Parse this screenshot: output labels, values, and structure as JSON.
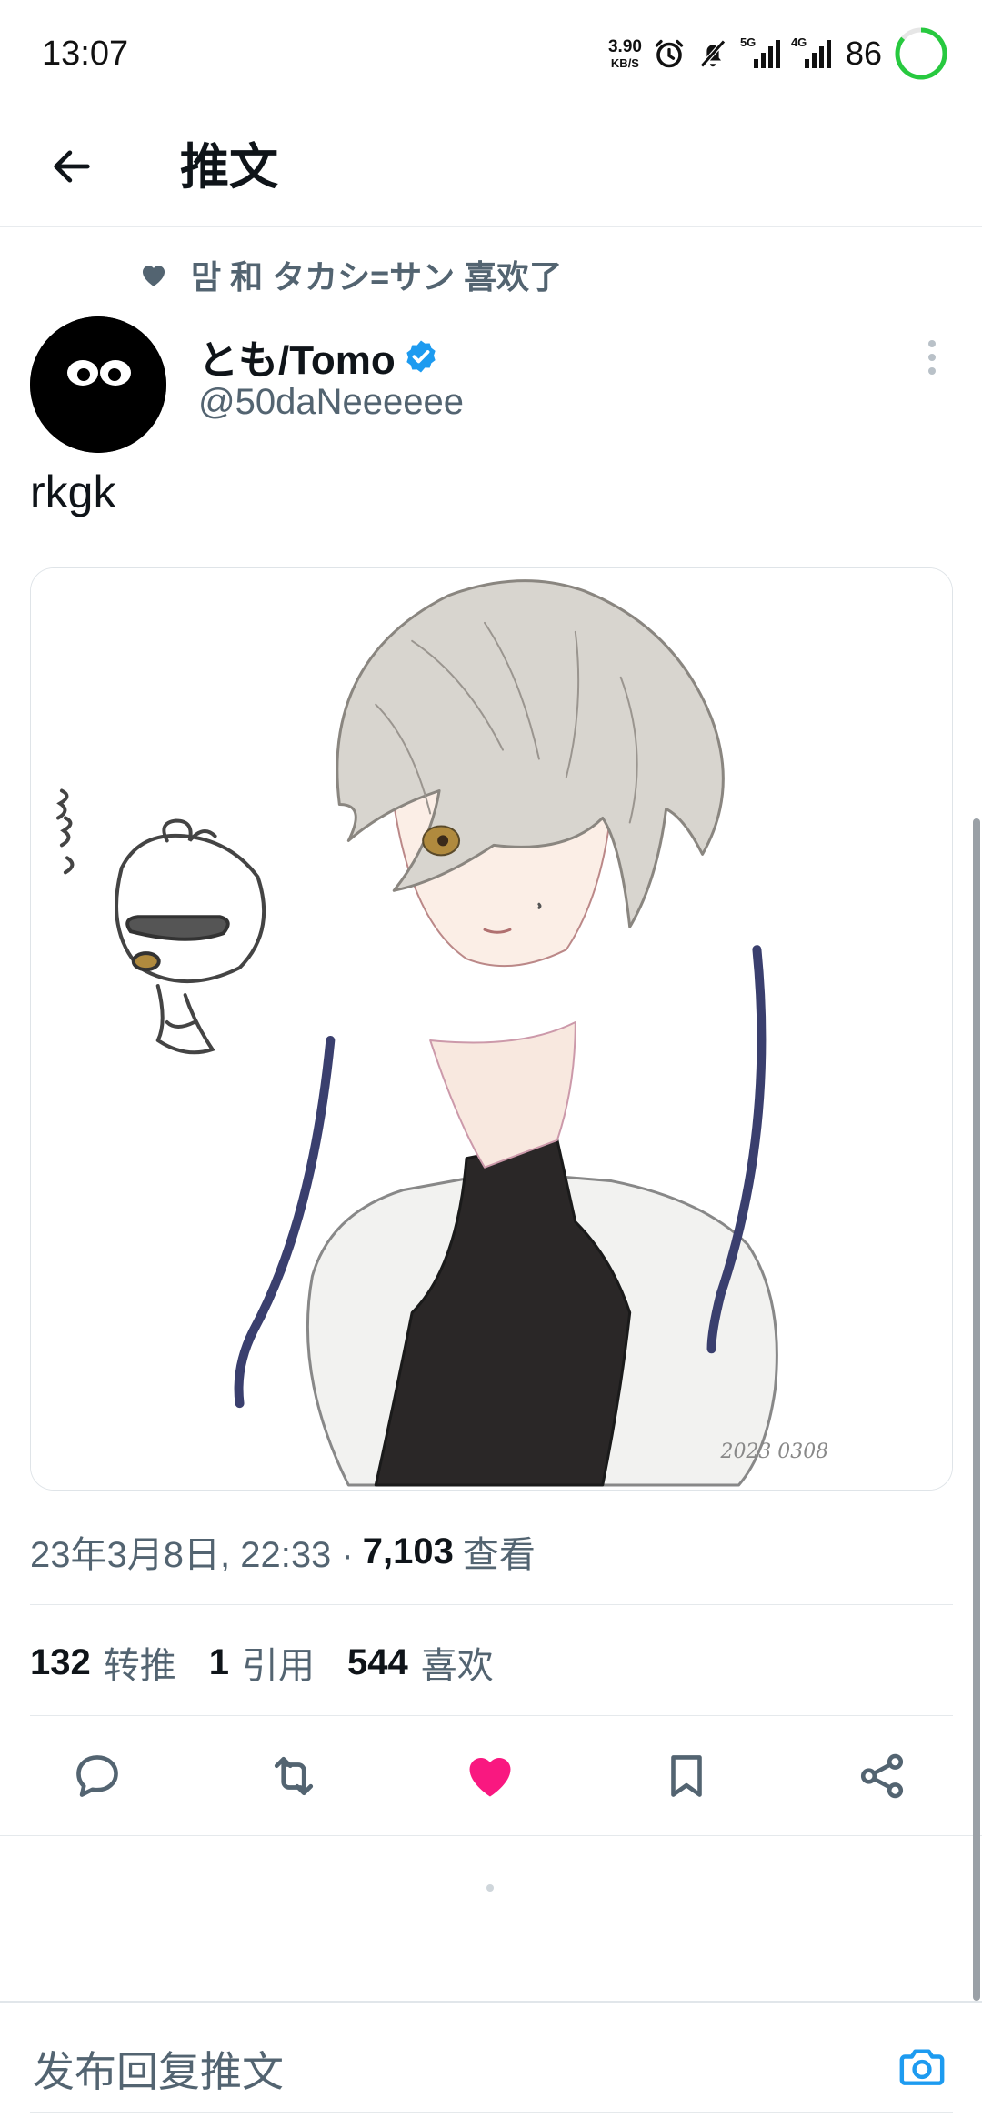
{
  "status_bar": {
    "time": "13:07",
    "net_speed_value": "3.90",
    "net_speed_unit": "KB/S",
    "signal_1_tag": "5G",
    "signal_2_tag": "4G",
    "battery_percent": "86",
    "icons": [
      "alarm-icon",
      "mute-bell-icon",
      "signal-5g-icon",
      "signal-4g-icon",
      "battery-ring-icon"
    ]
  },
  "header": {
    "title": "推文",
    "back_icon": "arrow-left-icon"
  },
  "tweet": {
    "liked_by": "맘 和 タカシ=サン 喜欢了",
    "author_name": "とも/Tomo",
    "author_handle": "@50daNeeeeee",
    "text": "rkgk",
    "timestamp": "23年3月8日, 22:33 ·",
    "views_count": "7,103",
    "views_label": "查看",
    "stats": {
      "retweets_count": "132",
      "retweets_label": "转推",
      "quotes_count": "1",
      "quotes_label": "引用",
      "likes_count": "544",
      "likes_label": "喜欢"
    },
    "media_signature": "2023 0308"
  },
  "actions": [
    {
      "name": "reply-icon"
    },
    {
      "name": "retweet-icon"
    },
    {
      "name": "like-icon",
      "active": true,
      "color": "#f91880"
    },
    {
      "name": "bookmark-icon"
    },
    {
      "name": "share-icon"
    }
  ],
  "reply_bar": {
    "placeholder": "发布回复推文",
    "camera_icon": "camera-icon",
    "accent": "#1d9bf0"
  }
}
